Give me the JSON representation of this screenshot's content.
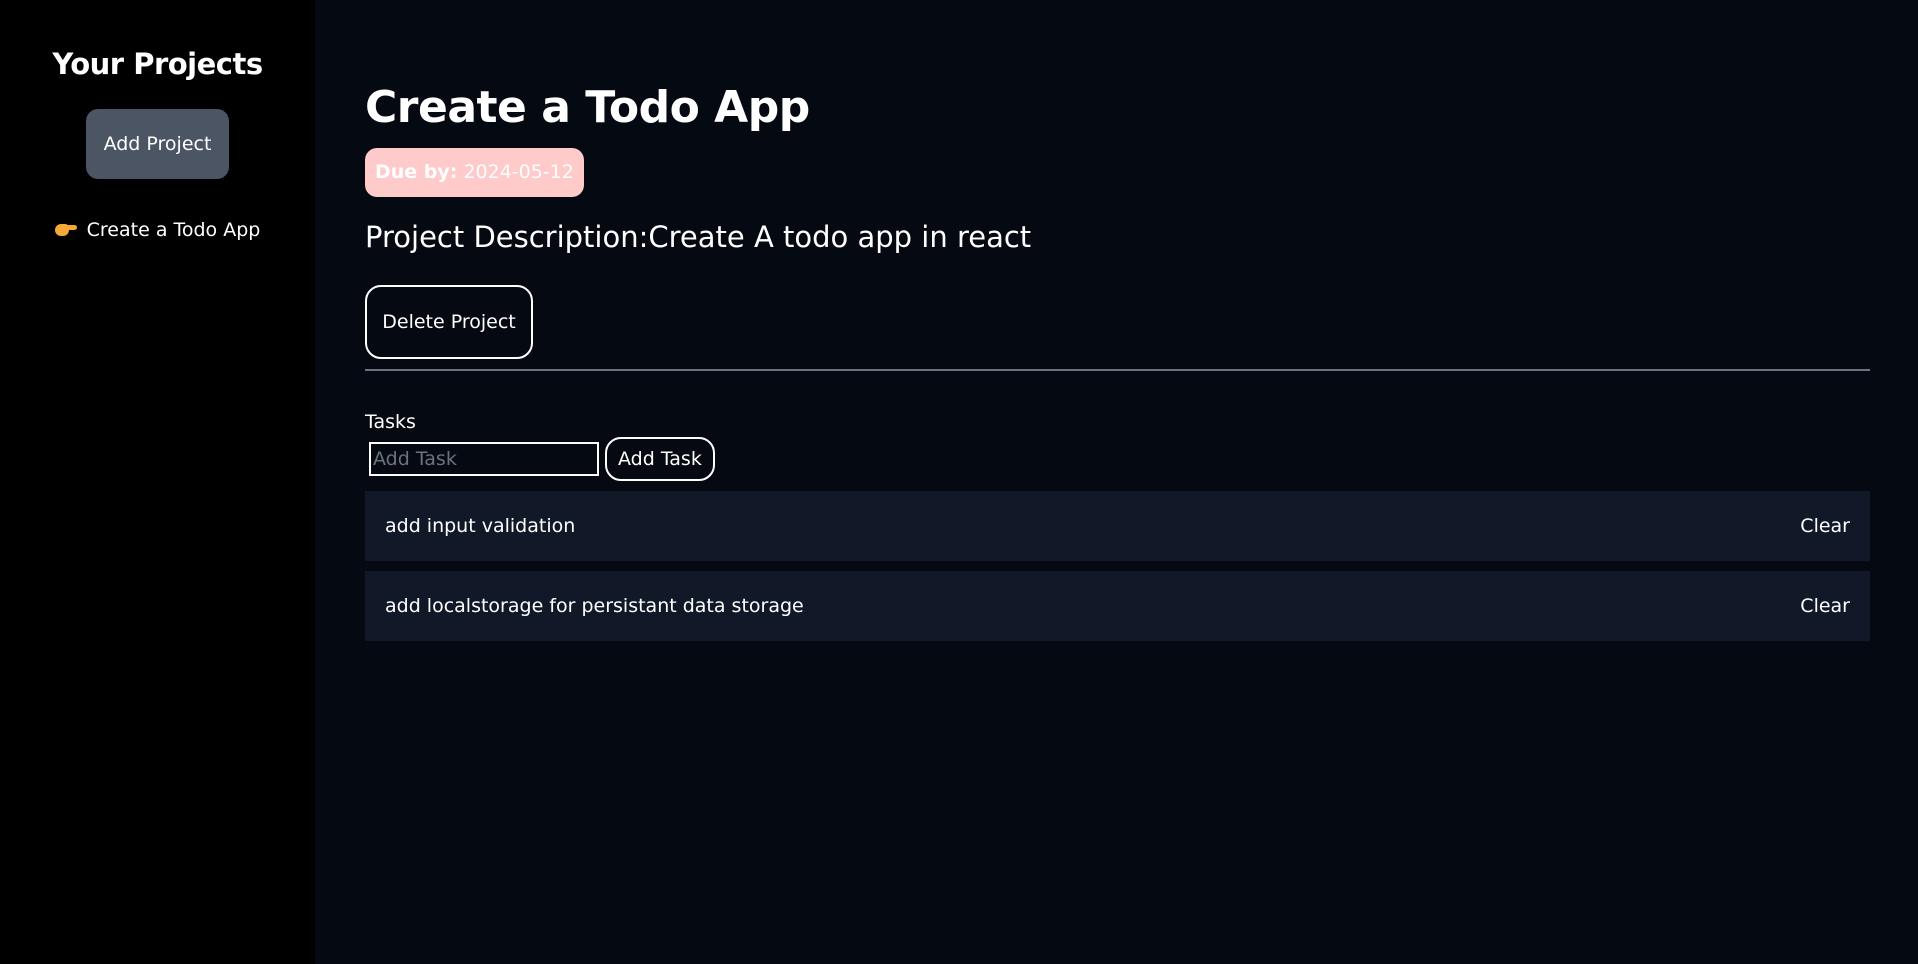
{
  "colors": {
    "sidebar_bg": "#000000",
    "main_bg": "#050911",
    "add_project_bg": "#4b5563",
    "due_badge_bg": "#fecaca",
    "task_bg": "#111827",
    "divider": "#6b7280"
  },
  "sidebar": {
    "title": "Your Projects",
    "add_project_label": "Add Project",
    "projects": [
      {
        "icon": "pointing-hand-icon",
        "label": "Create a Todo App"
      }
    ]
  },
  "project": {
    "title": "Create a Todo App",
    "due_label": "Due by:",
    "due_date": "2024-05-12",
    "description": "Project Description:Create A todo app in react",
    "delete_label": "Delete Project"
  },
  "tasks": {
    "label": "Tasks",
    "input_placeholder": "Add Task",
    "input_value": "",
    "add_label": "Add Task",
    "items": [
      {
        "text": "add input validation",
        "clear_label": "Clear"
      },
      {
        "text": "add localstorage for persistant data storage",
        "clear_label": "Clear"
      }
    ]
  }
}
